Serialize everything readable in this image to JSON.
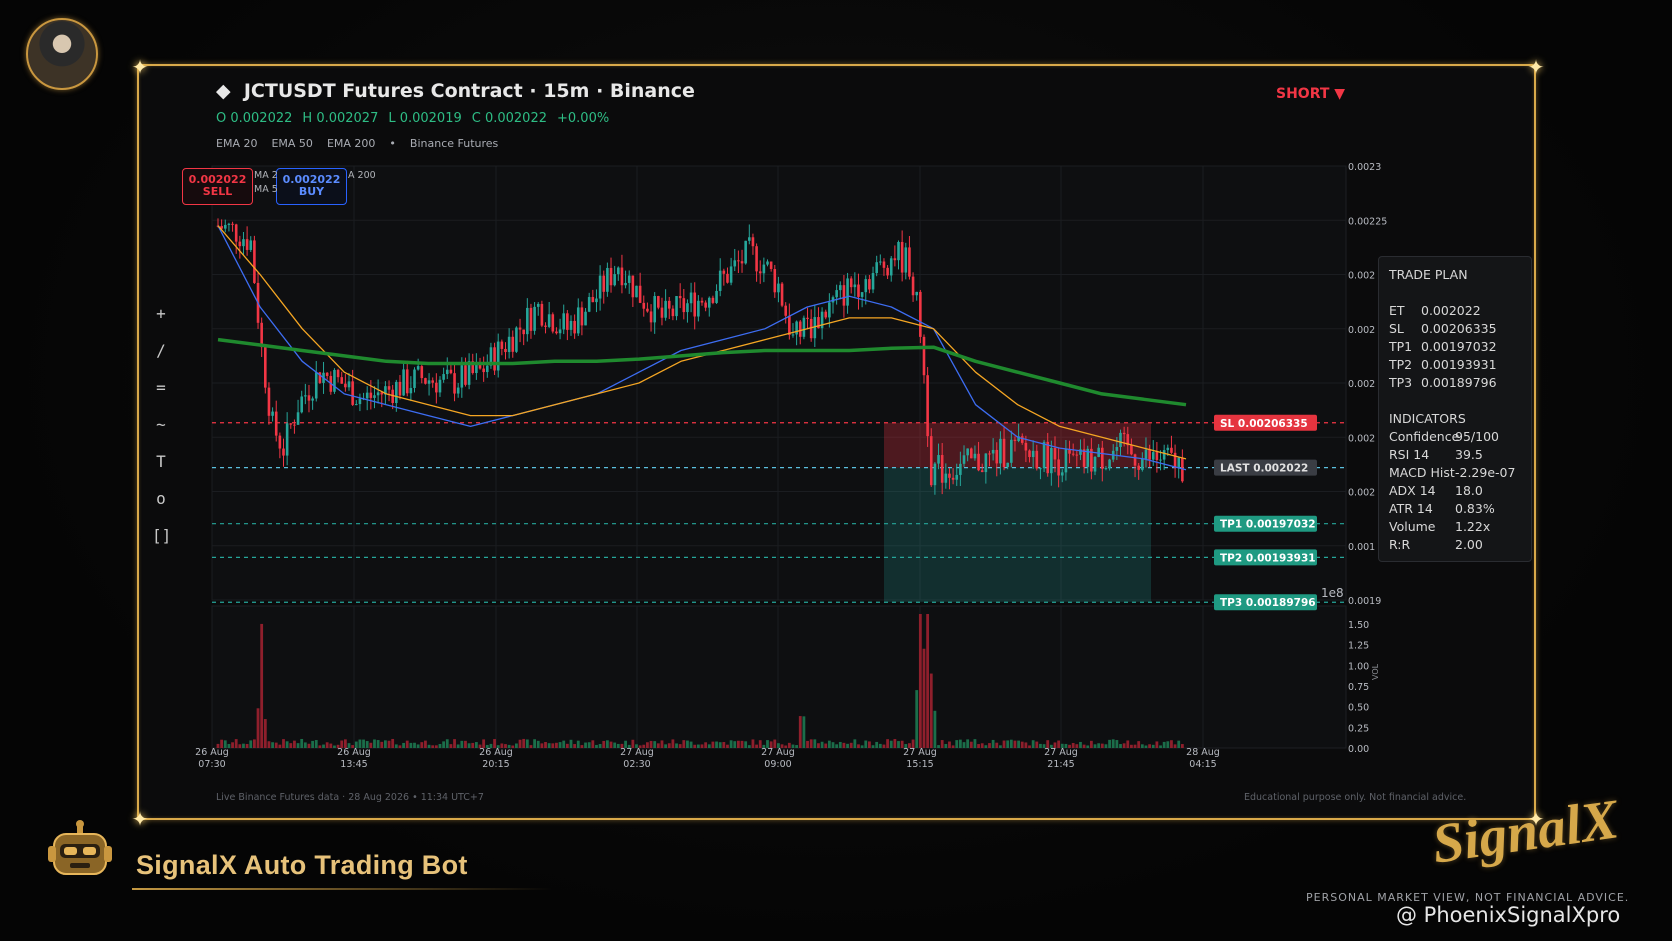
{
  "header": {
    "title": "JCTUSDT Futures Contract · 15m · Binance",
    "ohlc": {
      "o": "O 0.002022",
      "h": "H 0.002027",
      "l": "L 0.002019",
      "c": "C 0.002022",
      "chg": "+0.00%"
    },
    "indicators": [
      "EMA 20",
      "EMA 50",
      "EMA 200",
      "•",
      "Binance Futures"
    ],
    "side": "SHORT ▼"
  },
  "order_buttons": {
    "sell_price": "0.002022",
    "sell_label": "SELL",
    "buy_price": "0.002022",
    "buy_label": "BUY",
    "legend_fragment_1": "MA 2",
    "legend_fragment_2": "A 200",
    "legend_fragment_3": "MA 5"
  },
  "toolbar": [
    "+",
    "/",
    "=",
    "~",
    "T",
    "o",
    "[]"
  ],
  "price_labels": {
    "sl": "SL  0.00206335",
    "last": "LAST  0.002022",
    "tp1": "TP1  0.00197032",
    "tp2": "TP2  0.00193931",
    "tp3": "TP3  0.00189796"
  },
  "price_axis": [
    "0.0023",
    "0.00225",
    "0.002",
    "0.002",
    "0.002",
    "0.002",
    "0.002",
    "0.001",
    "0.0019"
  ],
  "axis_exponent": "1e8",
  "volume_axis": [
    "1.50",
    "1.25",
    "1.00",
    "0.75",
    "0.50",
    "0.25",
    "0.00"
  ],
  "volume_label": "VOL",
  "time_axis": [
    {
      "d": "26 Aug",
      "t": "07:30"
    },
    {
      "d": "26 Aug",
      "t": "13:45"
    },
    {
      "d": "26 Aug",
      "t": "20:15"
    },
    {
      "d": "27 Aug",
      "t": "02:30"
    },
    {
      "d": "27 Aug",
      "t": "09:00"
    },
    {
      "d": "27 Aug",
      "t": "15:15"
    },
    {
      "d": "27 Aug",
      "t": "21:45"
    },
    {
      "d": "28 Aug",
      "t": "04:15"
    }
  ],
  "trade_plan": {
    "title": "TRADE PLAN",
    "rows": [
      [
        "ET",
        "0.002022"
      ],
      [
        "SL",
        "0.00206335"
      ],
      [
        "TP1",
        "0.00197032"
      ],
      [
        "TP2",
        "0.00193931"
      ],
      [
        "TP3",
        "0.00189796"
      ]
    ],
    "ind_title": "INDICATORS",
    "ind_rows": [
      [
        "Confidence",
        "95/100"
      ],
      [
        "RSI 14",
        "39.5"
      ],
      [
        "MACD Hist",
        "-2.29e-07"
      ],
      [
        "ADX 14",
        "18.0"
      ],
      [
        "ATR 14",
        "0.83%"
      ],
      [
        "Volume",
        "1.22x"
      ],
      [
        "R:R",
        "2.00"
      ]
    ]
  },
  "footer": {
    "left": "Live Binance Futures data  ·  28 Aug 2026 • 11:34 UTC+7",
    "right": "Educational purpose only. Not financial advice."
  },
  "branding": {
    "bot_title": "SignalX Auto Trading Bot",
    "logo_text": "SignalX",
    "disclaimer": "PERSONAL MARKET VIEW, NOT FINANCIAL ADVICE.",
    "watermark": "@ PhoenixSignalXpro"
  },
  "colors": {
    "bull": "#26a69a",
    "bear": "#f23645",
    "ema20": "#3d6df2",
    "ema50": "#f5a623",
    "ema200": "#1f8a2e",
    "gold": "#d9a94a"
  },
  "chart_data": {
    "type": "line",
    "title": "JCTUSDT Futures Contract · 15m · Binance",
    "xlabel": "",
    "ylabel": "",
    "ylim": [
      0.0019,
      0.0023
    ],
    "series": [
      {
        "name": "EMA 20",
        "values": [
          0.002245,
          0.00217,
          0.00212,
          0.00209,
          0.00208,
          0.00207,
          0.00206,
          0.00207,
          0.00208,
          0.00209,
          0.00211,
          0.00213,
          0.00214,
          0.00215,
          0.00217,
          0.00218,
          0.00217,
          0.00215,
          0.00208,
          0.00205,
          0.00204,
          0.002035,
          0.00203,
          0.00202
        ]
      },
      {
        "name": "EMA 50",
        "values": [
          0.002245,
          0.0022,
          0.00215,
          0.00211,
          0.00209,
          0.00208,
          0.00207,
          0.00207,
          0.00208,
          0.00209,
          0.0021,
          0.00212,
          0.00213,
          0.00214,
          0.00215,
          0.00216,
          0.00216,
          0.00215,
          0.00211,
          0.00208,
          0.00206,
          0.00205,
          0.00204,
          0.00203
        ]
      },
      {
        "name": "EMA 200",
        "values": [
          0.00214,
          0.002135,
          0.00213,
          0.002125,
          0.00212,
          0.002118,
          0.002118,
          0.002118,
          0.00212,
          0.00212,
          0.002122,
          0.002125,
          0.002128,
          0.00213,
          0.00213,
          0.00213,
          0.002132,
          0.002133,
          0.00212,
          0.00211,
          0.0021,
          0.00209,
          0.002085,
          0.00208
        ]
      }
    ],
    "levels": {
      "sl": 0.00206335,
      "entry": 0.002022,
      "tp1": 0.00197032,
      "tp2": 0.00193931,
      "tp3": 0.00189796
    }
  }
}
